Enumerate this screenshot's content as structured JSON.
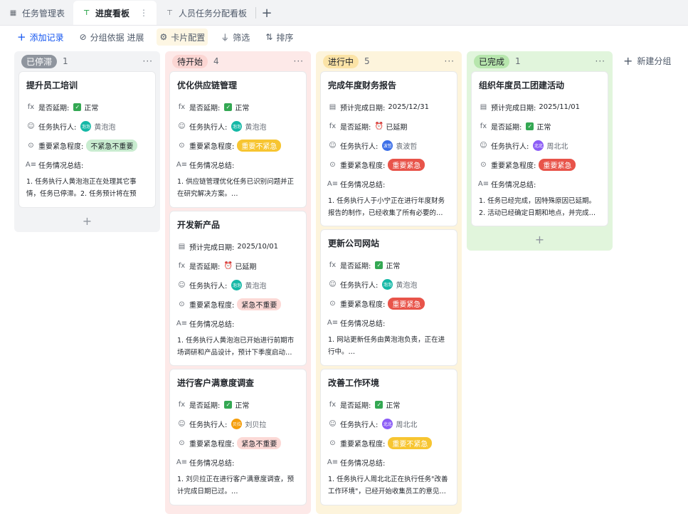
{
  "tabs": [
    {
      "label": "任务管理表",
      "icon": "table-icon"
    },
    {
      "label": "进度看板",
      "icon": "kanban-icon",
      "active": true
    },
    {
      "label": "人员任务分配看板",
      "icon": "kanban-icon"
    }
  ],
  "toolbar": {
    "add_record": "添加记录",
    "group_by": "分组依据 进展",
    "card_config": "卡片配置",
    "filter": "筛选",
    "sort": "排序"
  },
  "new_group": "新建分组",
  "field_labels": {
    "delayed": "是否延期:",
    "assignee": "任务执行人:",
    "priority": "重要紧急程度:",
    "summary": "任务情况总结:",
    "due": "预计完成日期:"
  },
  "colors": {
    "stopped_bg": "#f2f3f5",
    "stopped_tag": "#8f959e",
    "todo_bg": "#fde9e8",
    "todo_tag": "#fbd5d2",
    "doing_bg": "#fdf4dc",
    "doing_tag": "#fbe3a6",
    "done_bg": "#e1f5dc",
    "done_tag": "#b7e6ad"
  },
  "columns": [
    {
      "name": "已停滞",
      "count": "1",
      "cards": [
        {
          "title": "提升员工培训",
          "delayed": "正常",
          "delayed_type": "ok",
          "assignee": "黄泡泡",
          "avatar": "泡泡",
          "avatar_color": "#14b8a6",
          "priority": "不紧急不重要",
          "priority_style": "green",
          "summary": "1. 任务执行人黄泡泡正在处理其它事情，任务已停滞。2. 任务预计将在预定…"
        }
      ]
    },
    {
      "name": "待开始",
      "count": "4",
      "cards": [
        {
          "title": "优化供应链管理",
          "delayed": "正常",
          "delayed_type": "ok",
          "assignee": "黄泡泡",
          "avatar": "泡泡",
          "avatar_color": "#14b8a6",
          "priority": "重要不紧急",
          "priority_style": "yellow",
          "summary": "1. 供应链管理优化任务已识别问题并正在研究解决方案。…"
        },
        {
          "title": "开发新产品",
          "due": "2025/10/01",
          "delayed": "已延期",
          "delayed_type": "late",
          "assignee": "黄泡泡",
          "avatar": "泡泡",
          "avatar_color": "#14b8a6",
          "priority": "紧急不重要",
          "priority_style": "pink",
          "summary": "1. 任务执行人黄泡泡已开始进行前期市场调研和产品设计，预计下季度启动…"
        },
        {
          "title": "进行客户满意度调查",
          "delayed": "正常",
          "delayed_type": "ok",
          "assignee": "刘贝拉",
          "avatar": "贝拉",
          "avatar_color": "#f59e0b",
          "priority": "紧急不重要",
          "priority_style": "pink",
          "summary": "1. 刘贝拉正在进行客户满意度调查，预计完成日期已过。…"
        }
      ]
    },
    {
      "name": "进行中",
      "count": "5",
      "cards": [
        {
          "title": "完成年度财务报告",
          "due": "2025/12/31",
          "delayed": "已延期",
          "delayed_type": "late",
          "assignee": "袁波哲",
          "avatar": "波哲",
          "avatar_color": "#3b6ee8",
          "priority": "重要紧急",
          "priority_style": "red",
          "summary": "1. 任务执行人于小宁正在进行年度财务报告的制作，已经收集了所有必要的…"
        },
        {
          "title": "更新公司网站",
          "delayed": "正常",
          "delayed_type": "ok",
          "assignee": "黄泡泡",
          "avatar": "泡泡",
          "avatar_color": "#14b8a6",
          "priority": "重要紧急",
          "priority_style": "red",
          "summary": "1. 网站更新任务由黄泡泡负责，正在进行中。…"
        },
        {
          "title": "改善工作环境",
          "delayed": "正常",
          "delayed_type": "ok",
          "assignee": "周北北",
          "avatar": "北北",
          "avatar_color": "#8b5cf6",
          "priority": "重要不紧急",
          "priority_style": "yellow",
          "summary": "1. 任务执行人周北北正在执行任务\"改善工作环境\"，已经开始收集员工的意见…"
        }
      ]
    },
    {
      "name": "已完成",
      "count": "1",
      "cards": [
        {
          "title": "组织年度员工团建活动",
          "due": "2025/11/01",
          "delayed": "正常",
          "delayed_type": "ok",
          "assignee": "周北北",
          "avatar": "北北",
          "avatar_color": "#8b5cf6",
          "priority": "重要紧急",
          "priority_style": "red",
          "summary": "1. 任务已经完成，因特殊原因已延期。2. 活动已经确定日期和地点，并完成…"
        }
      ]
    }
  ]
}
